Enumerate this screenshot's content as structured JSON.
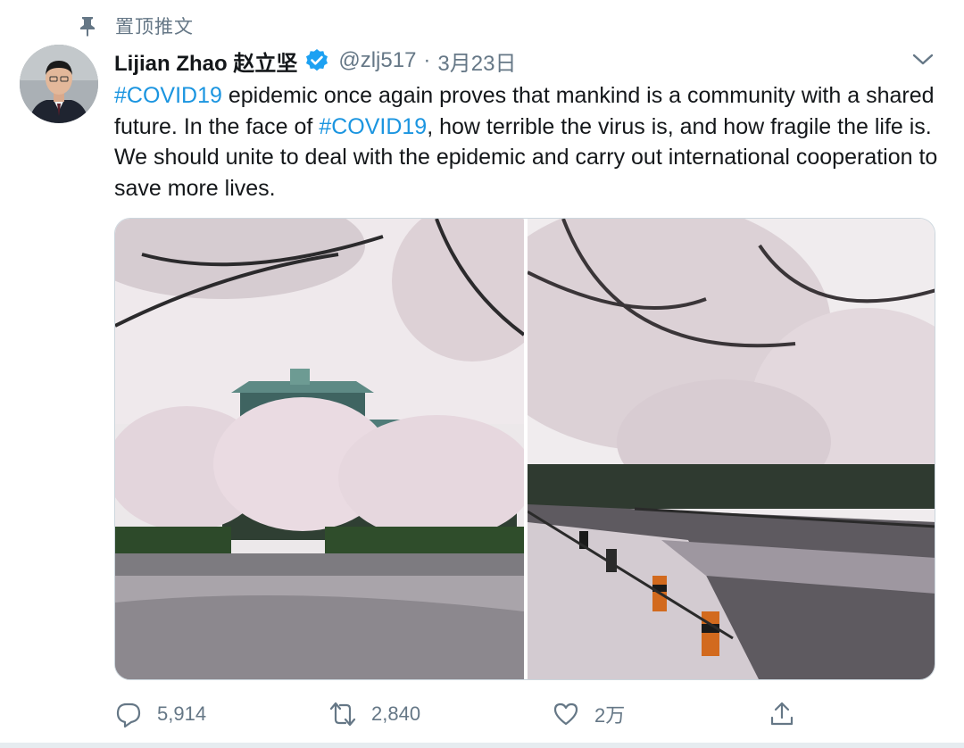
{
  "pinned": {
    "label": "置顶推文",
    "icon": "pin-icon"
  },
  "author": {
    "name": "Lijian Zhao 赵立坚",
    "handle": "@zlj517",
    "separator": "·",
    "date": "3月23日",
    "verified": true
  },
  "tweet": {
    "segments": [
      {
        "text": "#COVID19",
        "type": "hashtag"
      },
      {
        "text": " epidemic once again proves that mankind is a community with a shared future. In the face of ",
        "type": "text"
      },
      {
        "text": "#COVID19",
        "type": "hashtag"
      },
      {
        "text": ", how terrible the virus is, and how fragile the life is. We should unite to deal with the epidemic and carry out international cooperation to save more lives.",
        "type": "text"
      }
    ]
  },
  "media": {
    "photos": [
      {
        "name": "photo-cherry-blossom-building"
      },
      {
        "name": "photo-cherry-blossom-road"
      }
    ]
  },
  "actions": {
    "reply_count": "5,914",
    "retweet_count": "2,840",
    "like_count": "2万",
    "share_label": ""
  },
  "colors": {
    "accent": "#1b95e0",
    "secondary_text": "#657786",
    "border": "#ccd6dd"
  }
}
